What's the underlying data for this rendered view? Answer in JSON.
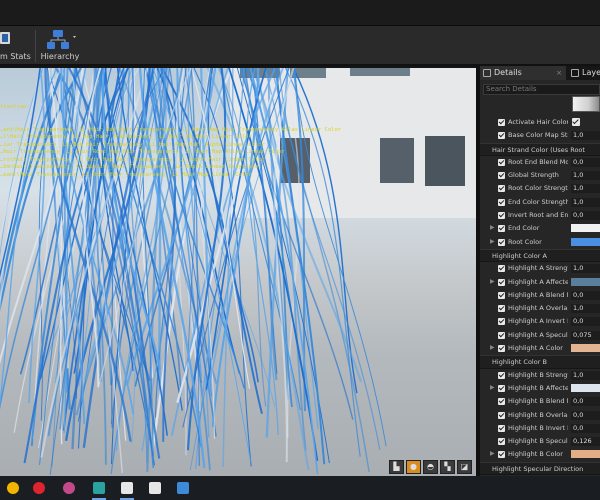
{
  "toolbar": {
    "stats_label": "m Stats",
    "hierarchy_label": "Hierarchy"
  },
  "viewport": {
    "stats_lines": [
      "ttaction:",
      "",
      "",
      "…ant\\Hair_Transparency__LL_Hair_Map_Hair_Transparency__LL_Hair_Map Hair Transparency Atlas Linear Color",
      "…l\\Hair_Transparency__LL_Map_Hair_Transparency__LL_Hair_ID_Hair Linear Color",
      "…iar_Transparency__LL_Map_Hair_Transparency__LL_Hair_Map_Hair_Alpha Linear Color",
      "…Hair_Transparency__LL_Hair_Root_Map_Hair_Transparency__LL_Hair_Map Atlas Linear Color",
      "…rs\\Hair_Transparency__LL_Hair_Map_Hair_Transparency__LL_Depth Hair Linear Color",
      "…bm\\Hair_Transparency__LL_Opacity_Hair_Transparency__LL_Depth Linear Grayscale",
      "…eant\\Hair_Transparency__LL_Root_Hair_Transparency__LL_Hair_Map Linear Color"
    ]
  },
  "panel": {
    "tabs": [
      {
        "label": "Details",
        "close": "×"
      },
      {
        "label": "Laye"
      }
    ],
    "search_placeholder": "Search Details",
    "rows": [
      {
        "type": "prop",
        "label": "Activate Hair Color",
        "kind": "checkbox"
      },
      {
        "type": "prop",
        "label": "Base Color Map Streng",
        "kind": "value",
        "value": "1,0"
      },
      {
        "type": "section",
        "label": "Hair Strand Color (Uses Root"
      },
      {
        "type": "prop",
        "label": "Root End Blend Mode",
        "kind": "value",
        "value": "0,0"
      },
      {
        "type": "prop",
        "label": "Global Strength",
        "kind": "value",
        "value": "1,0"
      },
      {
        "type": "prop",
        "label": "Root Color Strength",
        "kind": "value",
        "value": "1,0"
      },
      {
        "type": "prop",
        "label": "End Color Strength",
        "kind": "value",
        "value": "1,0"
      },
      {
        "type": "prop",
        "label": "Invert Root and End Col",
        "kind": "value",
        "value": "0,0"
      },
      {
        "type": "prop",
        "label": "End Color",
        "kind": "swatch",
        "color": "#f2f2f2",
        "arrow": true
      },
      {
        "type": "prop",
        "label": "Root Color",
        "kind": "swatch",
        "color": "#4a8fe0",
        "arrow": true
      },
      {
        "type": "section",
        "label": "Highlight Color A"
      },
      {
        "type": "prop",
        "label": "Highlight A Strength",
        "kind": "value",
        "value": "1,0"
      },
      {
        "type": "prop",
        "label": "Highlight A Affected Ra",
        "kind": "swatch",
        "color": "#5a7f9c",
        "arrow": true
      },
      {
        "type": "prop",
        "label": "Highlight A Blend Mode",
        "kind": "value",
        "value": "0,0"
      },
      {
        "type": "prop",
        "label": "Highlight A Overlap End",
        "kind": "value",
        "value": "1,0"
      },
      {
        "type": "prop",
        "label": "Highlight A Invert End t",
        "kind": "value",
        "value": "0,0"
      },
      {
        "type": "prop",
        "label": "Highlight A Specular St",
        "kind": "value",
        "value": "0,075"
      },
      {
        "type": "prop",
        "label": "Highlight A Color",
        "kind": "swatch",
        "color": "#e3b592",
        "arrow": true
      },
      {
        "type": "section",
        "label": "Highlight Color B"
      },
      {
        "type": "prop",
        "label": "Highlight B Strength",
        "kind": "value",
        "value": "1,0"
      },
      {
        "type": "prop",
        "label": "Highlight B Affected Ra",
        "kind": "swatch",
        "color": "#dde6ee",
        "arrow": true
      },
      {
        "type": "prop",
        "label": "Highlight B Blend Mode",
        "kind": "value",
        "value": "0,0"
      },
      {
        "type": "prop",
        "label": "Highlight B Overlap End",
        "kind": "value",
        "value": "0,0"
      },
      {
        "type": "prop",
        "label": "Highlight B Invert End t",
        "kind": "value",
        "value": "0,0"
      },
      {
        "type": "prop",
        "label": "Highlight B Specular St",
        "kind": "value",
        "value": "0,126"
      },
      {
        "type": "prop",
        "label": "Highlight B Color",
        "kind": "swatch",
        "color": "#e2ad87",
        "arrow": true
      },
      {
        "type": "section",
        "label": "Highlight Specular Direction"
      }
    ]
  },
  "taskbar": {
    "icons": [
      {
        "name": "chrome-icon",
        "color": "#f2b500"
      },
      {
        "name": "opera-icon",
        "color": "#e0242f"
      },
      {
        "name": "pink-app-icon",
        "color": "#c24a8a"
      },
      {
        "name": "maya-icon",
        "color": "#2aa3a0"
      },
      {
        "name": "unreal-icon",
        "color": "#e6e6e6"
      },
      {
        "name": "cube-app-icon",
        "color": "#e6e6e6"
      },
      {
        "name": "photos-icon",
        "color": "#3c8ad8"
      }
    ]
  }
}
